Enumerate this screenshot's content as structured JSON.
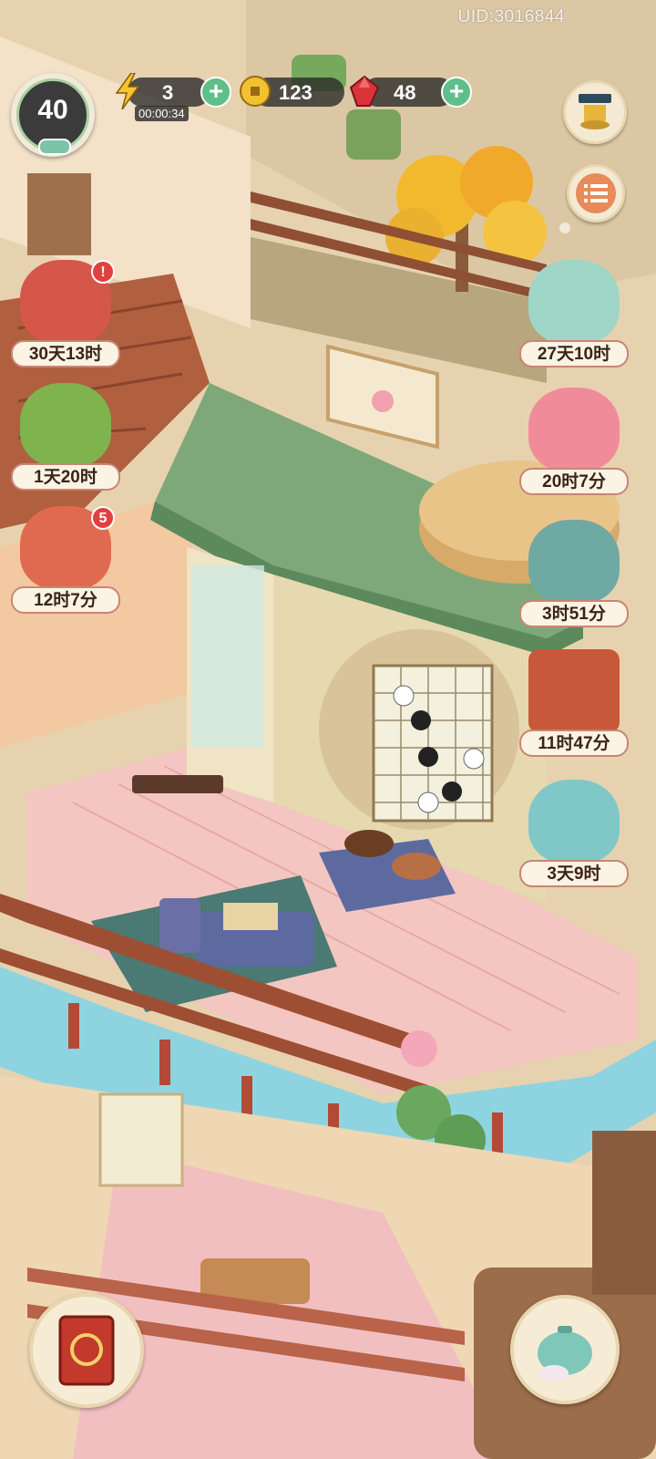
{
  "uid": "UID:3016844",
  "level": "40",
  "energy": {
    "value": "3",
    "timer": "00:00:34"
  },
  "coins": {
    "value": "123"
  },
  "gems": {
    "value": "48"
  },
  "left_events": [
    {
      "label": "30天13时",
      "badge": "!"
    },
    {
      "label": "1天20时",
      "badge": ""
    },
    {
      "label": "12时7分",
      "badge": "5"
    }
  ],
  "right_events": [
    {
      "label": "27天10时"
    },
    {
      "label": "20时7分"
    },
    {
      "label": "3时51分"
    },
    {
      "label": "11时47分"
    },
    {
      "label": "3天9时"
    }
  ],
  "colors": {
    "accent_green": "#5fbf8a",
    "label_border": "#c98575",
    "badge_red": "#e24040"
  }
}
